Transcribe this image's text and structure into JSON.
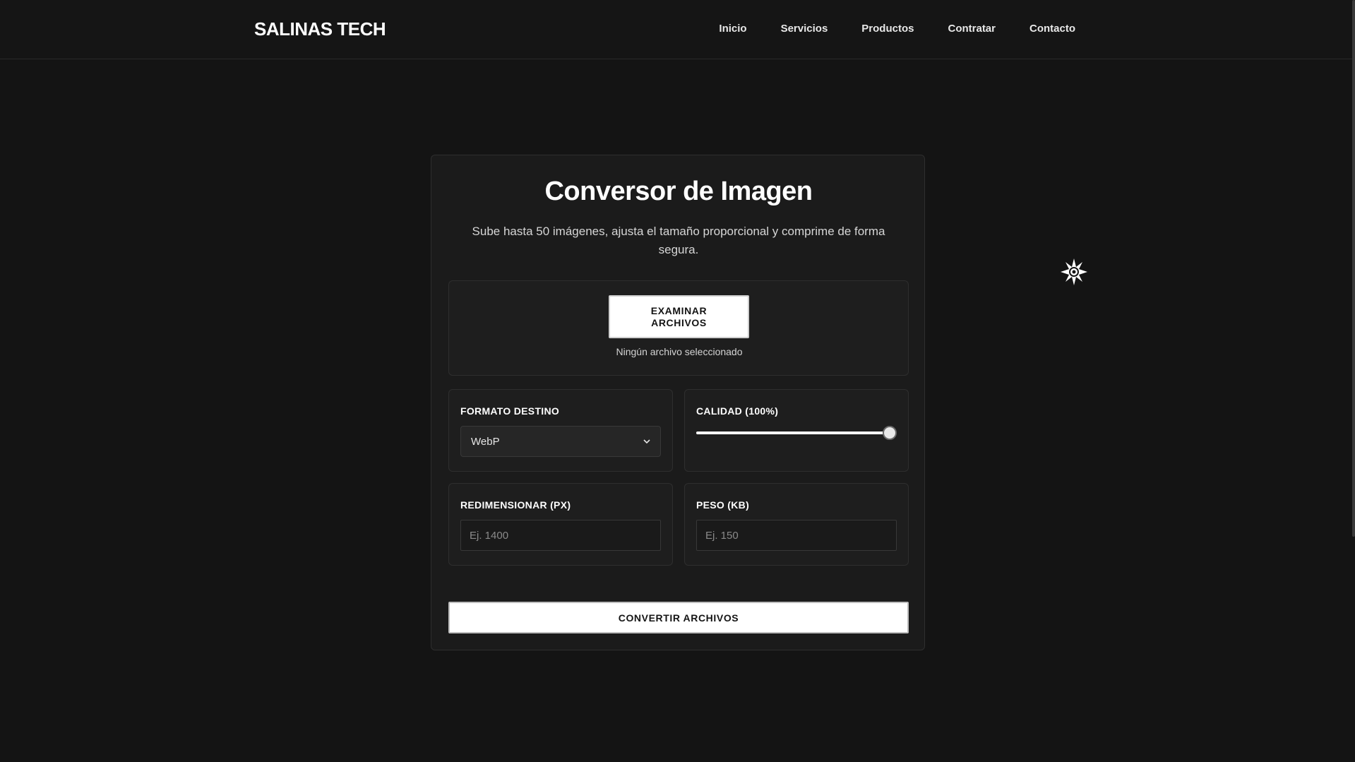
{
  "header": {
    "logo": "SALINAS TECH",
    "nav": [
      "Inicio",
      "Servicios",
      "Productos",
      "Contratar",
      "Contacto"
    ]
  },
  "theme_toggle": {
    "icon": "sun-icon"
  },
  "converter": {
    "title": "Conversor de Imagen",
    "subtitle": "Sube hasta 50 imágenes, ajusta el tamaño proporcional y comprime de forma segura.",
    "browse_label": "EXAMINAR ARCHIVOS",
    "file_status": "Ningún archivo seleccionado",
    "format": {
      "label": "FORMATO DESTINO",
      "selected": "WebP"
    },
    "quality": {
      "label": "CALIDAD (100%)",
      "value": 100,
      "min": 0,
      "max": 100
    },
    "resize": {
      "label": "REDIMENSIONAR (PX)",
      "placeholder": "Ej. 1400"
    },
    "weight": {
      "label": "PESO (KB)",
      "placeholder": "Ej. 150"
    },
    "convert_label": "CONVERTIR ARCHIVOS"
  },
  "colors": {
    "background": "#141414",
    "card": "#1b1b1b",
    "accent": "#ffffff"
  }
}
